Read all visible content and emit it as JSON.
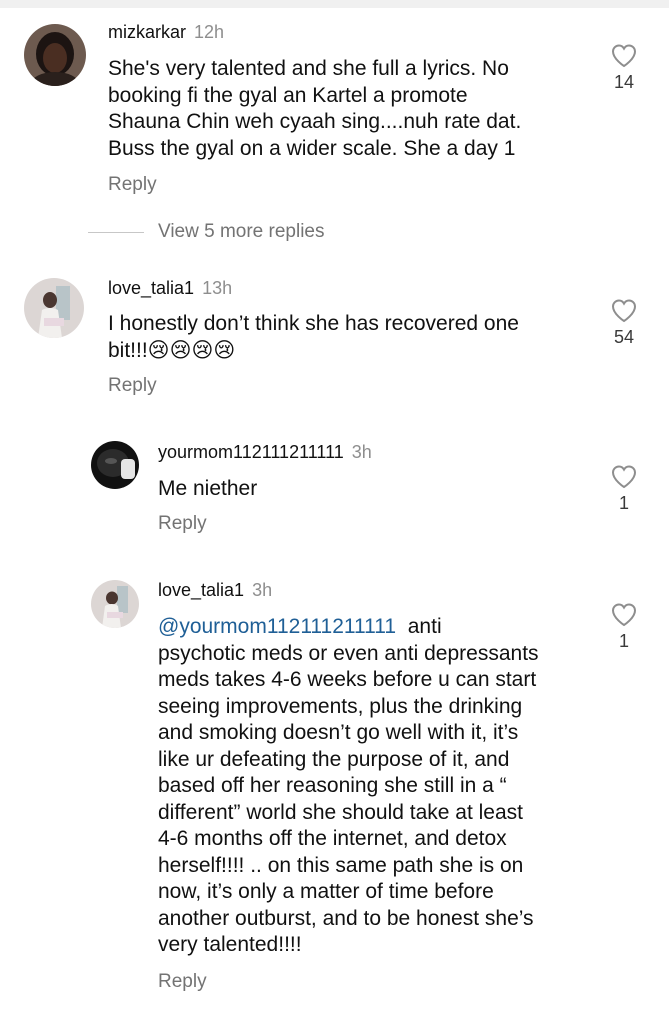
{
  "comments": [
    {
      "username": "mizkarkar",
      "time": "12h",
      "lines": [
        "She's very talented and she full a lyrics. No",
        "booking fi the gyal an Kartel a promote",
        "Shauna Chin weh cyaah sing....nuh rate dat.",
        "Buss the gyal on a wider scale. She a day 1"
      ],
      "reply_label": "Reply",
      "likes": "14",
      "avatar_icon": "profile-photo"
    },
    {
      "username": "love_talia1",
      "time": "13h",
      "lines": [
        "I honestly don’t think she has recovered one",
        "bit!!!😢😢😢😢"
      ],
      "reply_label": "Reply",
      "likes": "54",
      "avatar_icon": "profile-photo"
    },
    {
      "username": "yourmom112111211111",
      "time": "3h",
      "lines": [
        "Me niether"
      ],
      "reply_label": "Reply",
      "likes": "1",
      "avatar_icon": "profile-photo"
    },
    {
      "username": "love_talia1",
      "time": "3h",
      "mention": "@yourmom112111211111",
      "first_line_rest": "  anti",
      "lines": [
        "psychotic meds or even anti depressants",
        "meds takes 4-6 weeks before u can start",
        "seeing improvements, plus the drinking",
        "and smoking doesn’t go well with it, it’s",
        "like ur defeating the purpose of it, and",
        "based off her reasoning she still in a “",
        "different” world she should take at least",
        "4-6 months off the internet,  and detox",
        "herself!!!! .. on this same path she is on",
        "now, it’s only a matter of time before",
        "another outburst, and to be honest she’s",
        "very talented!!!!"
      ],
      "reply_label": "Reply",
      "likes": "1",
      "avatar_icon": "profile-photo"
    }
  ],
  "view_more_replies": "View 5 more replies",
  "icons": {
    "like": "heart-outline-icon"
  },
  "colors": {
    "mention": "#1f5f96",
    "secondary_text": "#737373",
    "timestamp": "#8e8e8e"
  }
}
